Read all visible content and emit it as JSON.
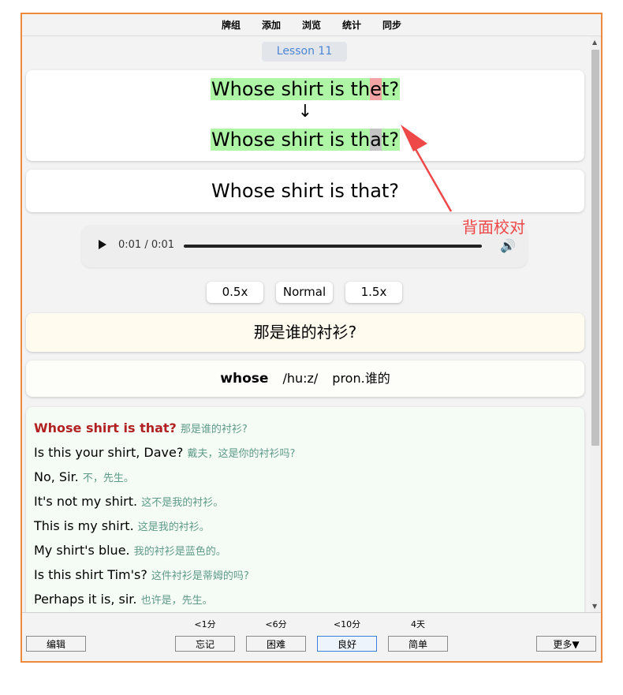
{
  "menu": {
    "decks": "牌组",
    "add": "添加",
    "browse": "浏览",
    "stats": "统计",
    "sync": "同步"
  },
  "lesson": "Lesson 11",
  "compare": {
    "typed_before": "Whose shirt is th",
    "typed_error": "e",
    "typed_after": "t?",
    "arrow": "↓",
    "expected_before": "Whose shirt is th",
    "expected_error": "a",
    "expected_after": "t?"
  },
  "answer": "Whose shirt is that?",
  "audio": {
    "time": "0:01 / 0:01",
    "progress": 1.0
  },
  "speeds": [
    "0.5x",
    "Normal",
    "1.5x"
  ],
  "translation": "那是谁的衬衫?",
  "word": {
    "term": "whose",
    "phonetic": "/hu:z/",
    "meaning": "pron.谁的"
  },
  "dialogue": [
    {
      "en": "Whose shirt is that?",
      "zh": "那是谁的衬衫?"
    },
    {
      "en": "Is this your shirt, Dave?",
      "zh": "戴夫，这是你的衬衫吗?"
    },
    {
      "en": "No, Sir.",
      "zh": "不，先生。"
    },
    {
      "en": "It's not my shirt.",
      "zh": "这不是我的衬衫。"
    },
    {
      "en": "This is my shirt.",
      "zh": "这是我的衬衫。"
    },
    {
      "en": "My shirt's blue.",
      "zh": "我的衬衫是蓝色的。"
    },
    {
      "en": "Is this shirt Tim's?",
      "zh": "这件衬衫是蒂姆的吗?"
    },
    {
      "en": "Perhaps it is, sir.",
      "zh": "也许是，先生。"
    }
  ],
  "annotation": "背面校对",
  "bottom": {
    "edit": "编辑",
    "more": "更多▼",
    "answers": [
      {
        "interval": "<1分",
        "label": "忘记"
      },
      {
        "interval": "<6分",
        "label": "困难"
      },
      {
        "interval": "<10分",
        "label": "良好"
      },
      {
        "interval": "4天",
        "label": "简单"
      }
    ]
  },
  "colors": {
    "border": "#ee8a3c",
    "highlight": "#aef5a6",
    "error_typed": "#f2a4a4",
    "error_expected": "#c4c4c4",
    "lesson_text": "#4b86d6",
    "title_red": "#b22222",
    "annotation": "#ee4848"
  }
}
